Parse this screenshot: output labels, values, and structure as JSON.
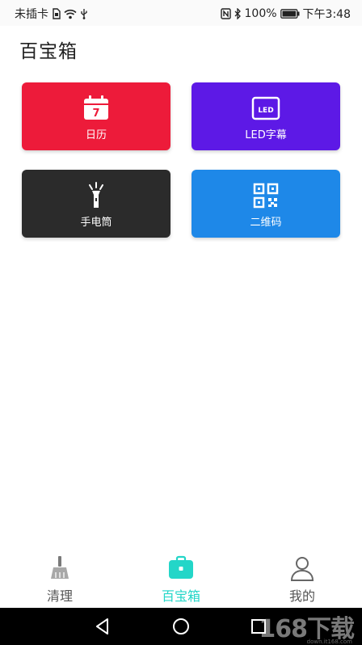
{
  "status_bar": {
    "sim_text": "未插卡",
    "battery_text": "100%",
    "time_text": "下午3:48",
    "icons": [
      "sim-card-icon",
      "wifi-icon",
      "usb-icon",
      "nfc-icon",
      "bluetooth-icon",
      "battery-icon"
    ]
  },
  "page": {
    "title": "百宝箱"
  },
  "tools": [
    {
      "label": "日历",
      "icon": "calendar-icon",
      "icon_text": "7",
      "color": "#ED1B3A"
    },
    {
      "label": "LED字幕",
      "icon": "led-icon",
      "icon_text": "LED",
      "color": "#5D19E6"
    },
    {
      "label": "手电筒",
      "icon": "flashlight-icon",
      "color": "#2B2B2B"
    },
    {
      "label": "二维码",
      "icon": "qrcode-icon",
      "color": "#1E88E8"
    }
  ],
  "bottom_nav": {
    "items": [
      {
        "label": "清理",
        "icon": "broom-icon",
        "active": false
      },
      {
        "label": "百宝箱",
        "icon": "toolbox-icon",
        "active": true
      },
      {
        "label": "我的",
        "icon": "user-icon",
        "active": false
      }
    ],
    "active_color": "#23D6C8",
    "inactive_color": "#555555"
  },
  "system_nav": {
    "icons": [
      "back-icon",
      "home-icon",
      "recent-apps-icon"
    ]
  },
  "watermark": {
    "main": "168下载",
    "sub": "down.it168.com"
  }
}
